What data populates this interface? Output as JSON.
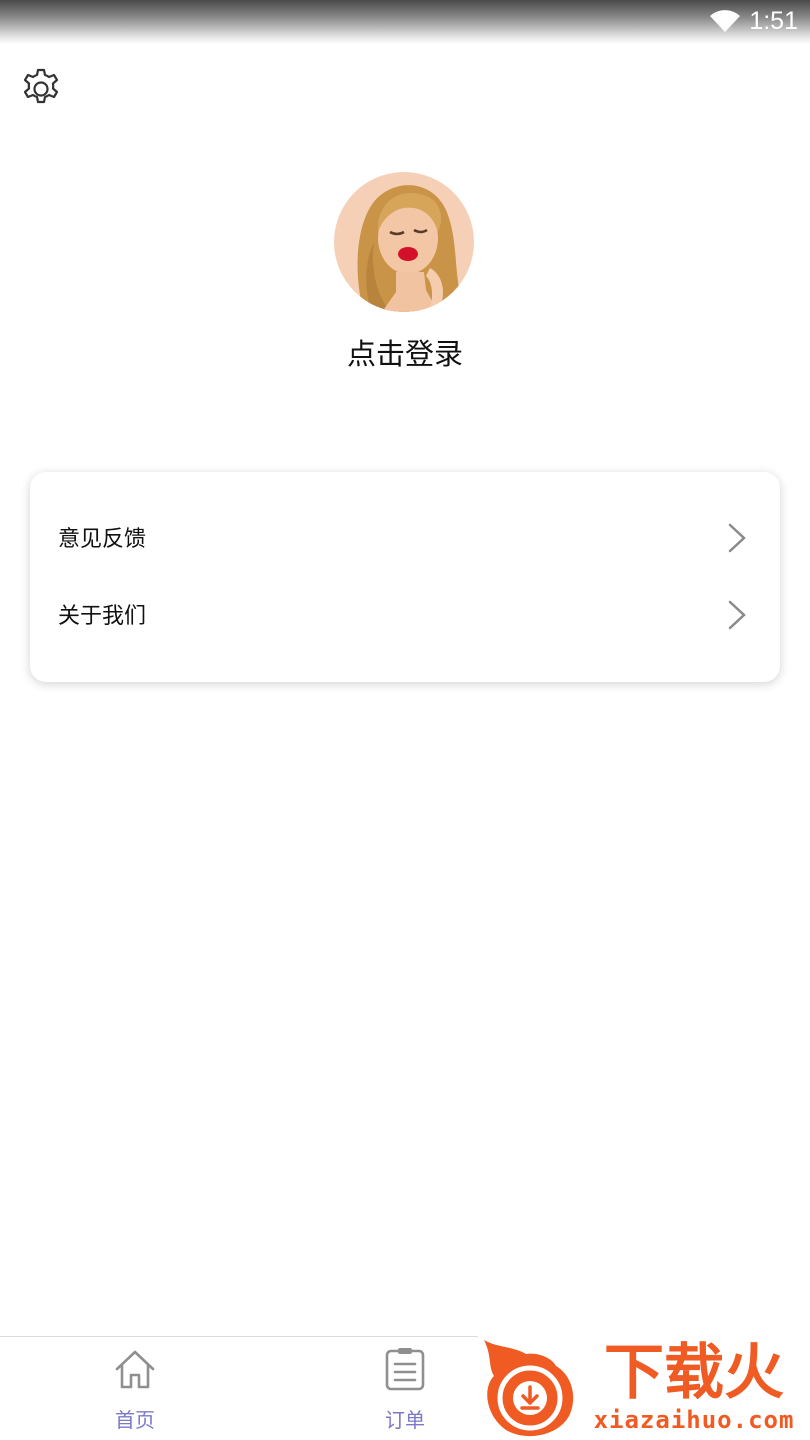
{
  "status_bar": {
    "time": "1:51",
    "wifi_icon": "wifi-icon"
  },
  "header": {
    "settings_icon": "gear-icon"
  },
  "profile": {
    "avatar_alt": "avatar",
    "login_label": "点击登录"
  },
  "menu": {
    "items": [
      {
        "label": "意见反馈",
        "icon": "chevron-right-icon"
      },
      {
        "label": "关于我们",
        "icon": "chevron-right-icon"
      }
    ]
  },
  "bottom_nav": {
    "tabs": [
      {
        "label": "首页",
        "icon": "home-icon"
      },
      {
        "label": "订单",
        "icon": "clipboard-icon"
      }
    ],
    "active_color": "#7b78c8"
  },
  "watermark": {
    "brand": "下载火",
    "url": "xiazaihuo.com",
    "color": "#f05a23"
  }
}
